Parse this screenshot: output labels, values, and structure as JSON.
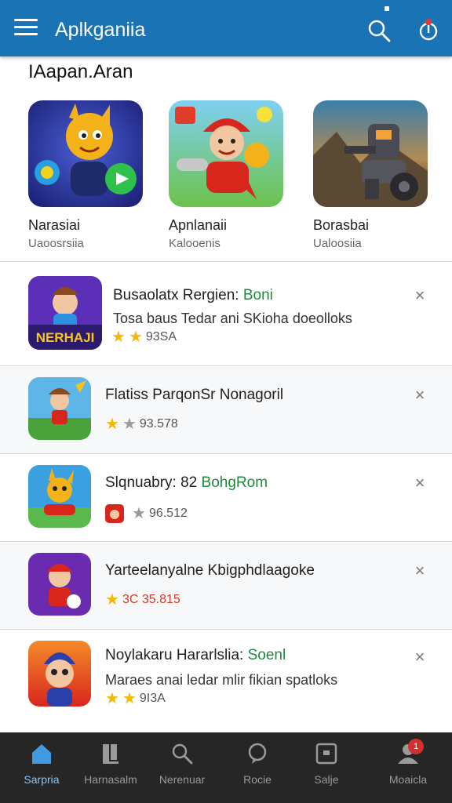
{
  "appbar": {
    "title": "Aplkganiia",
    "menu_icon": "hamburger-menu-icon",
    "search_icon": "search-icon",
    "notify_icon": "notification-icon"
  },
  "featured": {
    "section_title": "IAapan.Aran",
    "items": [
      {
        "name": "Narasiai",
        "subtitle": "Uaoosrsiia",
        "icon": "cartoon-cat-hero-art"
      },
      {
        "name": "Apnlanaii",
        "subtitle": "Kalooenis",
        "icon": "red-helmet-kid-art"
      },
      {
        "name": "Borasbai",
        "subtitle": "Ualoosiia",
        "icon": "mech-robot-art"
      }
    ]
  },
  "list": [
    {
      "title": "Busaolatx Rergien: ",
      "title_accent": "Boni",
      "desc": "Tosa baus Tedar ani SKioha doeolloks",
      "rating": "93SA",
      "stars": 2,
      "icon_caption": "NERHAJI"
    },
    {
      "title": "Flatiss ParqonSr Nonagoril",
      "title_accent": "",
      "desc": "",
      "rating": "93.578",
      "stars": 1,
      "gray_stars": 1
    },
    {
      "title": "Slqnuabry: 82 ",
      "title_accent": "BohgRom",
      "desc": "",
      "rating": "96.512",
      "mini_icon": true,
      "gray_stars": 1
    },
    {
      "title": "Yarteelanyalne Kbigphdlaagoke",
      "title_accent": "",
      "desc": "",
      "rating": "3C 35.815",
      "stars": 1,
      "red_rating": true
    },
    {
      "title": "Noylakaru Hararlslia: ",
      "title_accent": "Soenl",
      "desc": "Maraes anai ledar mlir fikian spatloks",
      "rating": "9I3A",
      "stars": 2
    }
  ],
  "close_glyph": "×",
  "bottom_nav": [
    {
      "label": "Sarpria",
      "icon": "home-icon",
      "active": true
    },
    {
      "label": "Harnasalm",
      "icon": "library-icon"
    },
    {
      "label": "Nerenuar",
      "icon": "search-icon"
    },
    {
      "label": "Rocie",
      "icon": "chat-icon"
    },
    {
      "label": "Salje",
      "icon": "media-icon"
    },
    {
      "label": "Moaicla",
      "icon": "profile-icon",
      "badge": "1"
    }
  ],
  "colors": {
    "appbar": "#1a73b5",
    "accent_green": "#1e8a3c",
    "star": "#f5b800",
    "bottom_nav": "#262626",
    "nav_active": "#8fc4ee"
  }
}
